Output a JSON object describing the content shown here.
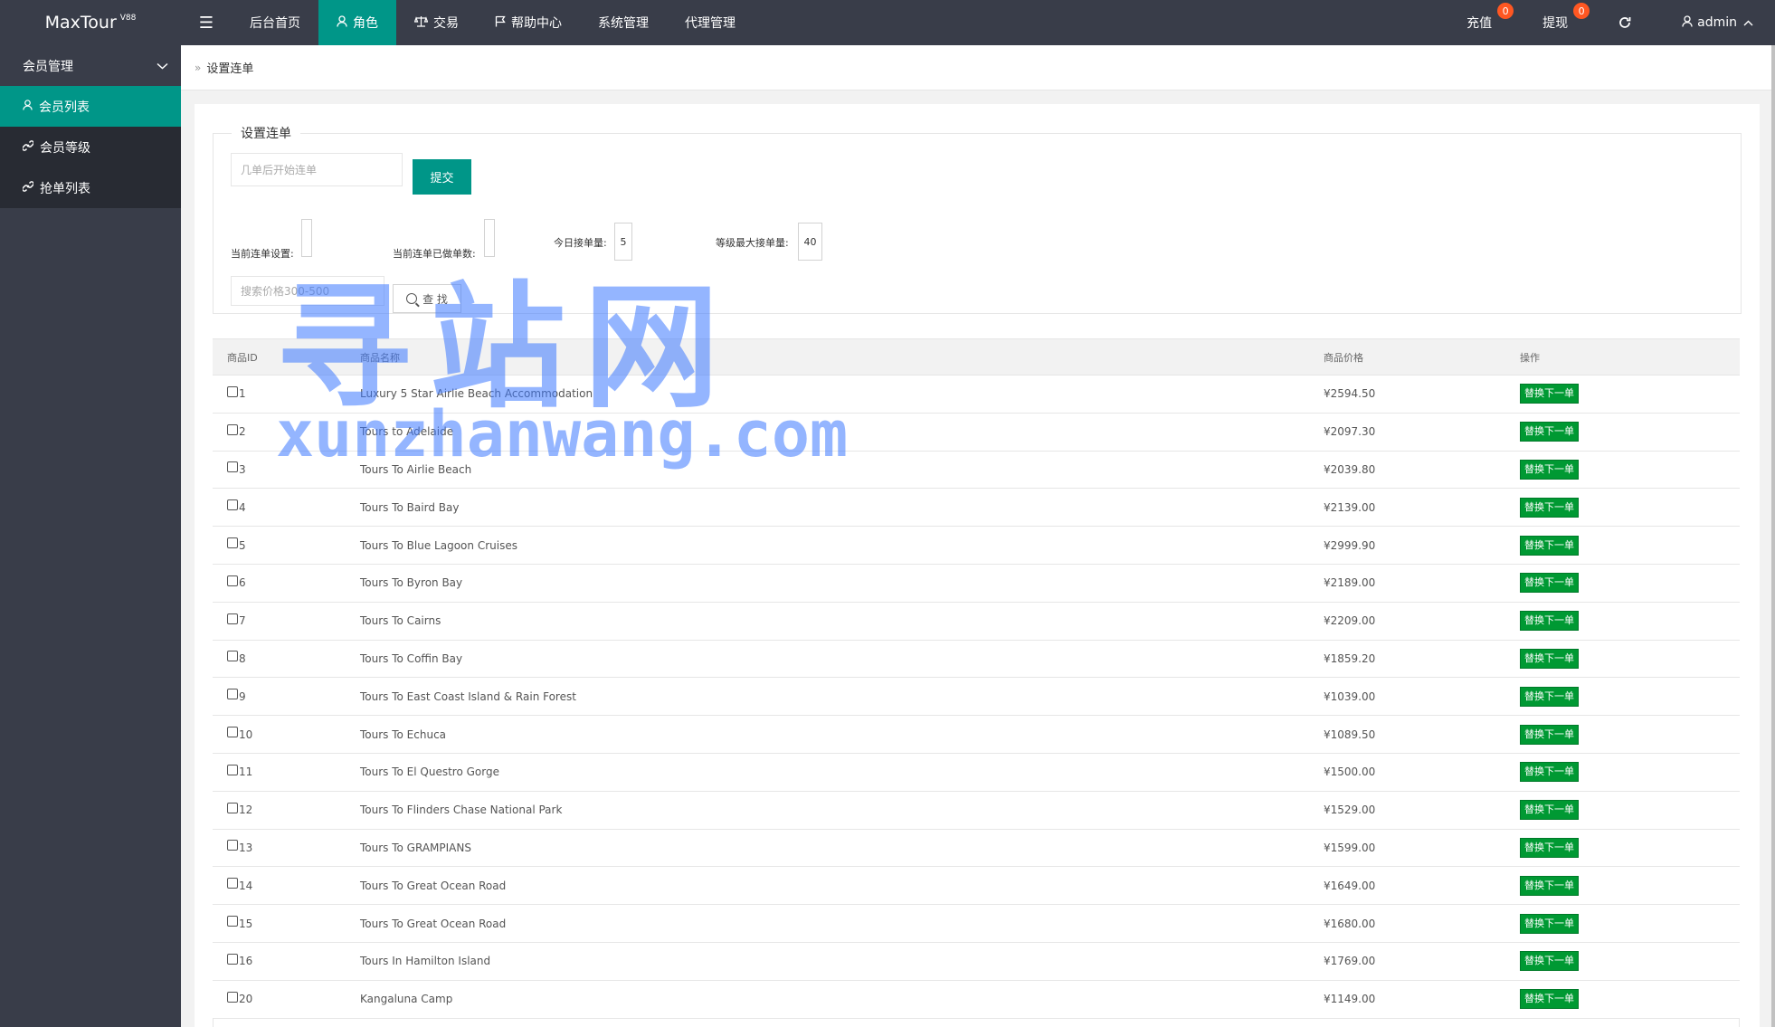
{
  "header": {
    "logo": "MaxTour",
    "logo_version": "V88",
    "nav": [
      {
        "label": "后台首页",
        "icon": ""
      },
      {
        "label": "角色",
        "icon": "user-icon"
      },
      {
        "label": "交易",
        "icon": "scale-icon"
      },
      {
        "label": "帮助中心",
        "icon": "flag-icon"
      },
      {
        "label": "系统管理",
        "icon": ""
      },
      {
        "label": "代理管理",
        "icon": ""
      }
    ],
    "recharge": {
      "label": "充值",
      "badge": "0"
    },
    "withdraw": {
      "label": "提现",
      "badge": "0"
    },
    "user": "admin"
  },
  "sidebar": {
    "group": "会员管理",
    "items": [
      {
        "label": "会员列表",
        "icon": "user-icon",
        "active": true
      },
      {
        "label": "会员等级",
        "icon": "link-icon",
        "active": false
      },
      {
        "label": "抢单列表",
        "icon": "link-icon",
        "active": false
      }
    ]
  },
  "breadcrumb": {
    "sep": "»",
    "current": "设置连单"
  },
  "form": {
    "legend": "设置连单",
    "start_placeholder": "几单后开始连单",
    "submit_label": "提交",
    "current_setting_label": "当前连单设置:",
    "done_label": "当前连单已做单数:",
    "today_label": "今日接单量:",
    "today_value": "5",
    "level_max_label": "等级最大接单量:",
    "level_max_value": "40",
    "search_placeholder": "搜索价格300-500",
    "search_label": "查 找"
  },
  "table": {
    "headers": [
      "商品ID",
      "商品名称",
      "商品价格",
      "操作"
    ],
    "action_label": "替换下一单",
    "rows": [
      {
        "id": "1",
        "name": "Luxury 5 Star Airlie Beach Accommodation",
        "price": "¥2594.50"
      },
      {
        "id": "2",
        "name": "Tours to Adelaide",
        "price": "¥2097.30"
      },
      {
        "id": "3",
        "name": "Tours To Airlie Beach",
        "price": "¥2039.80"
      },
      {
        "id": "4",
        "name": "Tours To Baird Bay",
        "price": "¥2139.00"
      },
      {
        "id": "5",
        "name": "Tours To Blue Lagoon Cruises",
        "price": "¥2999.90"
      },
      {
        "id": "6",
        "name": "Tours To Byron Bay",
        "price": "¥2189.00"
      },
      {
        "id": "7",
        "name": "Tours To Cairns",
        "price": "¥2209.00"
      },
      {
        "id": "8",
        "name": "Tours To Coffin Bay",
        "price": "¥1859.20"
      },
      {
        "id": "9",
        "name": "Tours To East Coast Island & Rain Forest",
        "price": "¥1039.00"
      },
      {
        "id": "10",
        "name": "Tours To Echuca",
        "price": "¥1089.50"
      },
      {
        "id": "11",
        "name": "Tours To El Questro Gorge",
        "price": "¥1500.00"
      },
      {
        "id": "12",
        "name": "Tours To Flinders Chase National Park",
        "price": "¥1529.00"
      },
      {
        "id": "13",
        "name": "Tours To GRAMPIANS",
        "price": "¥1599.00"
      },
      {
        "id": "14",
        "name": "Tours To Great Ocean Road",
        "price": "¥1649.00"
      },
      {
        "id": "15",
        "name": "Tours To Great Ocean Road",
        "price": "¥1680.00"
      },
      {
        "id": "16",
        "name": "Tours In Hamilton Island",
        "price": "¥1769.00"
      },
      {
        "id": "20",
        "name": "Kangaluna Camp",
        "price": "¥1149.00"
      }
    ]
  },
  "watermark": {
    "big": "寻站网",
    "small": "xunzhanwang.com"
  },
  "colors": {
    "topbar": "#393d49",
    "accent": "#009688",
    "action_button": "#009933",
    "badge": "#ff5722"
  }
}
